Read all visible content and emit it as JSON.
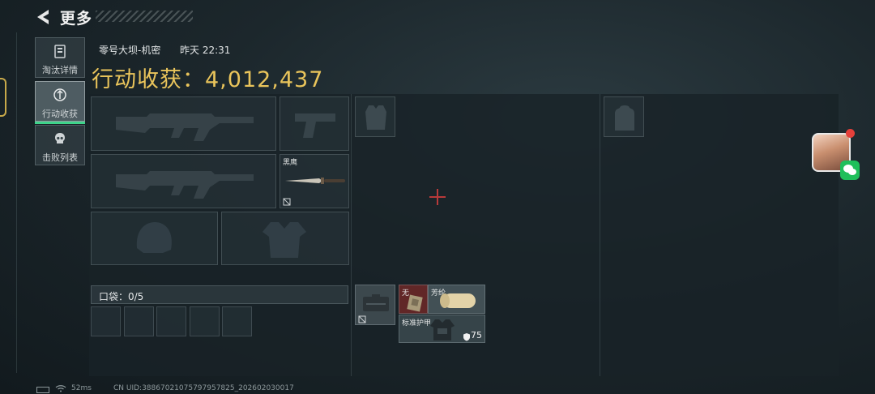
{
  "header": {
    "title": "更多"
  },
  "side_tabs": [
    {
      "label": "淘汰详情",
      "icon": "clipboard-icon"
    },
    {
      "label": "行动收获",
      "icon": "loot-icon",
      "active": true
    },
    {
      "label": "击败列表",
      "icon": "skull-icon"
    }
  ],
  "match": {
    "map": "零号大坝-机密",
    "time": "昨天 22:31",
    "haul": "行动收获：4,012,437"
  },
  "equipment": {
    "primary_weapon_1": {
      "icon": "assault-rifle-icon"
    },
    "pistol": {
      "icon": "pistol-icon"
    },
    "primary_weapon_2": {
      "icon": "assault-rifle-icon"
    },
    "melee": {
      "label": "黑鹰",
      "icon": "knife-icon",
      "badge_icon": "no-trade-icon"
    },
    "helmet": {
      "icon": "helmet-icon"
    },
    "armor": {
      "icon": "armor-vest-icon"
    },
    "chest_rig": {
      "icon": "chest-rig-icon"
    },
    "backpack": {
      "icon": "backpack-icon"
    }
  },
  "pocket": {
    "label": "口袋：0/5",
    "slots": 5
  },
  "loot_items": [
    {
      "name": "case-item",
      "icon": "case-icon",
      "badge_icon": "no-trade-icon"
    },
    {
      "name": "small-item",
      "label": "无",
      "icon": "package-icon"
    },
    {
      "name": "roll-item",
      "label": "芳纶",
      "icon": "fabric-roll-icon"
    },
    {
      "name": "vest-item",
      "label": "标准护甲",
      "icon": "armor-vest-icon",
      "durability": "75"
    }
  ],
  "social": {
    "avatar_icon": "player-avatar",
    "wechat_icon": "wechat-icon"
  },
  "footer": {
    "ping": "52ms",
    "uid": "CN UID:38867021075797957825_202602030017"
  },
  "colors": {
    "accent_gold": "#e9c45b",
    "active_green": "#3ed38a",
    "crosshair_red": "#b83a3a"
  }
}
